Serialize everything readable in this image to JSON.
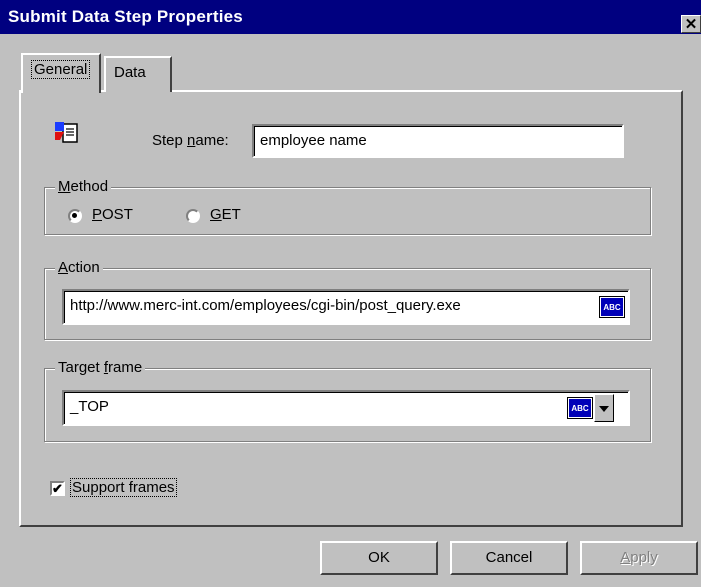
{
  "window": {
    "title": "Submit Data Step Properties",
    "close_label": "✕"
  },
  "tabs": [
    {
      "label": "General"
    },
    {
      "label": "Data"
    }
  ],
  "step": {
    "icon": "submit-data-step-icon",
    "name_label_pre": "Step ",
    "name_label_accel": "n",
    "name_label_post": "ame:",
    "name_value": "employee name"
  },
  "method": {
    "title_accel": "M",
    "title_rest": "ethod",
    "options": [
      {
        "accel": "P",
        "rest": "OST",
        "checked": true
      },
      {
        "accel": "G",
        "rest": "ET",
        "checked": false
      }
    ]
  },
  "action": {
    "title_accel": "A",
    "title_rest": "ction",
    "value": "http://www.merc-int.com/employees/cgi-bin/post_query.exe",
    "abc_text": "ABC"
  },
  "target_frame": {
    "title_pre": "Target ",
    "title_accel": "f",
    "title_post": "rame",
    "value": "_TOP",
    "abc_text": "ABC"
  },
  "support_frames": {
    "label": "Support frames",
    "checked": true,
    "check_mark": "✔"
  },
  "buttons": {
    "ok": "OK",
    "cancel": "Cancel",
    "apply_accel": "A",
    "apply_rest": "pply"
  },
  "colors": {
    "titlebar": "#000080",
    "face": "#c0c0c0",
    "abc_badge": "#0000b8"
  }
}
